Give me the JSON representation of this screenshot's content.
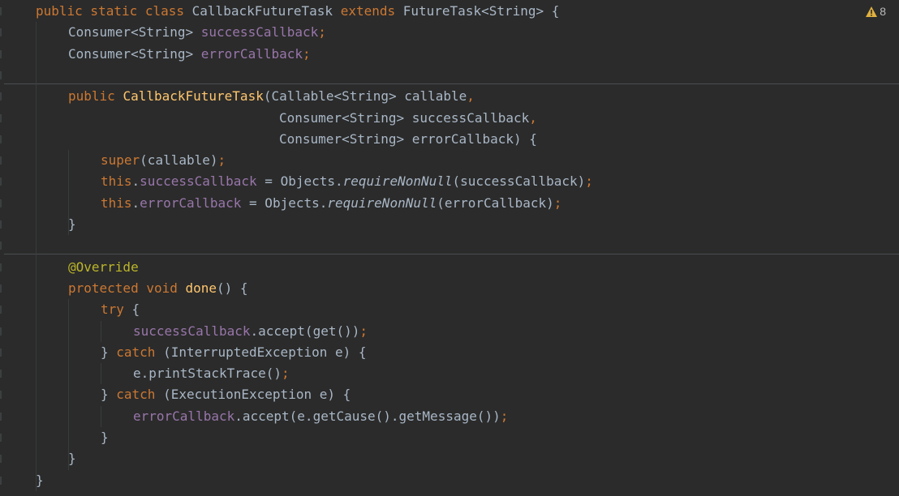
{
  "editor": {
    "language": "java",
    "warning_count": "8",
    "lines": [
      {
        "indent": 1,
        "tokens": [
          {
            "t": "public static class ",
            "c": "kw"
          },
          {
            "t": "CallbackFutureTask ",
            "c": "pl"
          },
          {
            "t": "extends ",
            "c": "kw"
          },
          {
            "t": "FutureTask<String> {",
            "c": "pl"
          }
        ]
      },
      {
        "indent": 2,
        "tokens": [
          {
            "t": "Consumer<String> ",
            "c": "pl"
          },
          {
            "t": "successCallback",
            "c": "fld"
          },
          {
            "t": ";",
            "c": "semi"
          }
        ]
      },
      {
        "indent": 2,
        "tokens": [
          {
            "t": "Consumer<String> ",
            "c": "pl"
          },
          {
            "t": "errorCallback",
            "c": "fld"
          },
          {
            "t": ";",
            "c": "semi"
          }
        ]
      },
      {
        "indent": 0,
        "tokens": []
      },
      {
        "indent": 2,
        "tokens": [
          {
            "t": "public ",
            "c": "kw"
          },
          {
            "t": "CallbackFutureTask",
            "c": "fn"
          },
          {
            "t": "(Callable<String> callable",
            "c": "pl"
          },
          {
            "t": ",",
            "c": "semi"
          }
        ]
      },
      {
        "indent": 8,
        "tokens": [
          {
            "t": "Consumer<String> successCallback",
            "c": "pl"
          },
          {
            "t": ",",
            "c": "semi"
          }
        ]
      },
      {
        "indent": 8,
        "tokens": [
          {
            "t": "Consumer<String> errorCallback) {",
            "c": "pl"
          }
        ]
      },
      {
        "indent": 3,
        "tokens": [
          {
            "t": "super",
            "c": "kw"
          },
          {
            "t": "(callable)",
            "c": "pl"
          },
          {
            "t": ";",
            "c": "semi"
          }
        ]
      },
      {
        "indent": 3,
        "tokens": [
          {
            "t": "this",
            "c": "kw"
          },
          {
            "t": ".",
            "c": "pl"
          },
          {
            "t": "successCallback",
            "c": "fld"
          },
          {
            "t": " = Objects.",
            "c": "pl"
          },
          {
            "t": "requireNonNull",
            "c": "pl it"
          },
          {
            "t": "(successCallback)",
            "c": "pl"
          },
          {
            "t": ";",
            "c": "semi"
          }
        ]
      },
      {
        "indent": 3,
        "tokens": [
          {
            "t": "this",
            "c": "kw"
          },
          {
            "t": ".",
            "c": "pl"
          },
          {
            "t": "errorCallback",
            "c": "fld"
          },
          {
            "t": " = Objects.",
            "c": "pl"
          },
          {
            "t": "requireNonNull",
            "c": "pl it"
          },
          {
            "t": "(errorCallback)",
            "c": "pl"
          },
          {
            "t": ";",
            "c": "semi"
          }
        ]
      },
      {
        "indent": 2,
        "tokens": [
          {
            "t": "}",
            "c": "pl"
          }
        ]
      },
      {
        "indent": 0,
        "tokens": []
      },
      {
        "indent": 2,
        "tokens": [
          {
            "t": "@Override",
            "c": "ann"
          }
        ]
      },
      {
        "indent": 2,
        "tokens": [
          {
            "t": "protected void ",
            "c": "kw"
          },
          {
            "t": "done",
            "c": "fn"
          },
          {
            "t": "() {",
            "c": "pl"
          }
        ]
      },
      {
        "indent": 3,
        "tokens": [
          {
            "t": "try ",
            "c": "kw"
          },
          {
            "t": "{",
            "c": "pl"
          }
        ]
      },
      {
        "indent": 4,
        "tokens": [
          {
            "t": "successCallback",
            "c": "fld"
          },
          {
            "t": ".accept(get())",
            "c": "pl"
          },
          {
            "t": ";",
            "c": "semi"
          }
        ]
      },
      {
        "indent": 3,
        "tokens": [
          {
            "t": "} ",
            "c": "pl"
          },
          {
            "t": "catch ",
            "c": "kw"
          },
          {
            "t": "(InterruptedException e) {",
            "c": "pl"
          }
        ]
      },
      {
        "indent": 4,
        "tokens": [
          {
            "t": "e.printStackTrace()",
            "c": "pl"
          },
          {
            "t": ";",
            "c": "semi"
          }
        ]
      },
      {
        "indent": 3,
        "tokens": [
          {
            "t": "} ",
            "c": "pl"
          },
          {
            "t": "catch ",
            "c": "kw"
          },
          {
            "t": "(ExecutionException e) {",
            "c": "pl"
          }
        ]
      },
      {
        "indent": 4,
        "tokens": [
          {
            "t": "errorCallback",
            "c": "fld"
          },
          {
            "t": ".accept(e.getCause().getMessage())",
            "c": "pl"
          },
          {
            "t": ";",
            "c": "semi"
          }
        ]
      },
      {
        "indent": 3,
        "tokens": [
          {
            "t": "}",
            "c": "pl"
          }
        ]
      },
      {
        "indent": 2,
        "tokens": [
          {
            "t": "}",
            "c": "pl"
          }
        ]
      },
      {
        "indent": 1,
        "tokens": [
          {
            "t": "}",
            "c": "pl"
          }
        ]
      }
    ]
  },
  "colors": {
    "background": "#2b2b2b",
    "keyword": "#cc7832",
    "field": "#9876aa",
    "method_decl": "#ffc66d",
    "annotation": "#bbb529",
    "plain": "#a9b7c6",
    "warning": "#e0b040"
  }
}
